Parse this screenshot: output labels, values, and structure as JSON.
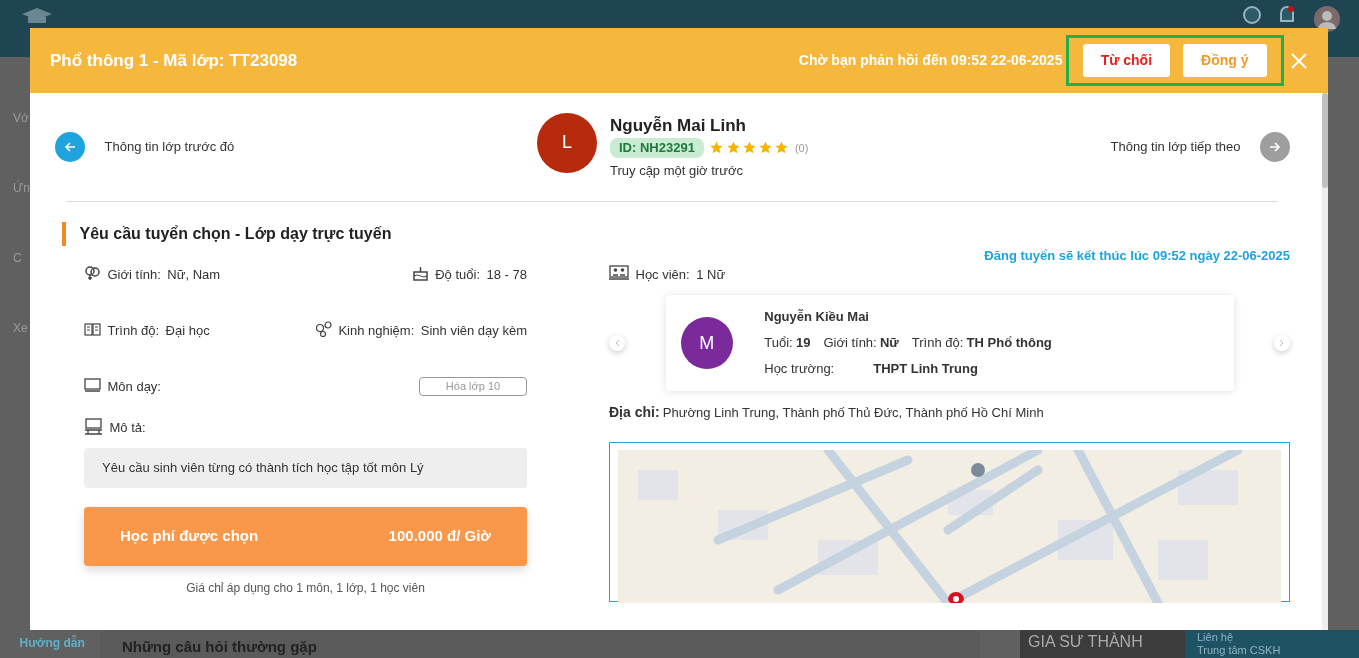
{
  "background": {
    "sidebar_fragments": [
      "Vớ",
      "Ứn",
      "C",
      "Xe"
    ],
    "guide_link": "Hướng dẫn",
    "faq_title": "Những câu hỏi thường gặp",
    "banner": "GIA SƯ THÀNH",
    "contact": {
      "title": "Liên hệ",
      "subtitle": "Trung tâm CSKH"
    }
  },
  "modal": {
    "title": "Phổ thông 1 - Mã lớp: TT23098",
    "deadline": "Chờ bạn phản hồi đến 09:52 22-06-2025",
    "buttons": [
      {
        "label": "Từ chối",
        "kind": "reject"
      },
      {
        "label": "Đồng ý",
        "kind": "accept"
      }
    ]
  },
  "navigation": {
    "prev_label": "Thông tin lớp trước đó",
    "next_label": "Thông tin lớp tiếp theo"
  },
  "tutor": {
    "initial": "L",
    "name": "Nguyễn Mai Linh",
    "id": "ID: NH23291",
    "stars": 5,
    "rating_count": "(0)",
    "last_seen": "Truy cập một giờ trước"
  },
  "section_title": "Yêu cầu tuyển chọn - Lớp dạy trực tuyến",
  "end_notice": "Đăng tuyển sẽ kết thúc lúc 09:52 ngày 22-06-2025",
  "requirements": [
    {
      "kind": "gender",
      "label": "Giới tính:",
      "value": "Nữ, Nam"
    },
    {
      "kind": "age",
      "label": "Độ tuổi:",
      "value": "18 - 78"
    },
    {
      "kind": "level",
      "label": "Trình độ:",
      "value": "Đại học"
    },
    {
      "kind": "experience",
      "label": "Kinh nghiệm:",
      "value": "Sinh viên dạy kèm"
    }
  ],
  "subjects": {
    "label": "Môn dạy:",
    "tags": [
      "Hóa lớp 10"
    ]
  },
  "description": {
    "label": "Mô tả:",
    "text": "Yêu cầu sinh viên từng có thành tích học tập tốt môn Lý"
  },
  "fee": {
    "label": "Học phí được chọn",
    "value": "100.000 đ/ Giờ",
    "note": "Giá chỉ áp dụng cho 1 môn, 1 lớp, 1 học viên"
  },
  "students": {
    "label": "Học viên:",
    "value": "1 Nữ",
    "items": [
      {
        "initial": "M",
        "name": "Nguyễn Kiều Mai",
        "age_label": "Tuổi:",
        "age": "19",
        "gender_label": "Giới tính:",
        "gender": "Nữ",
        "level_label": "Trình độ:",
        "level": "TH Phổ thông",
        "school_label": "Học trường:",
        "school": "THPT Linh Trung"
      }
    ]
  },
  "address": {
    "label": "Địa chỉ:",
    "value": "Phường Linh Trung, Thành phố Thủ Đức, Thành phố Hồ Chí Minh"
  }
}
